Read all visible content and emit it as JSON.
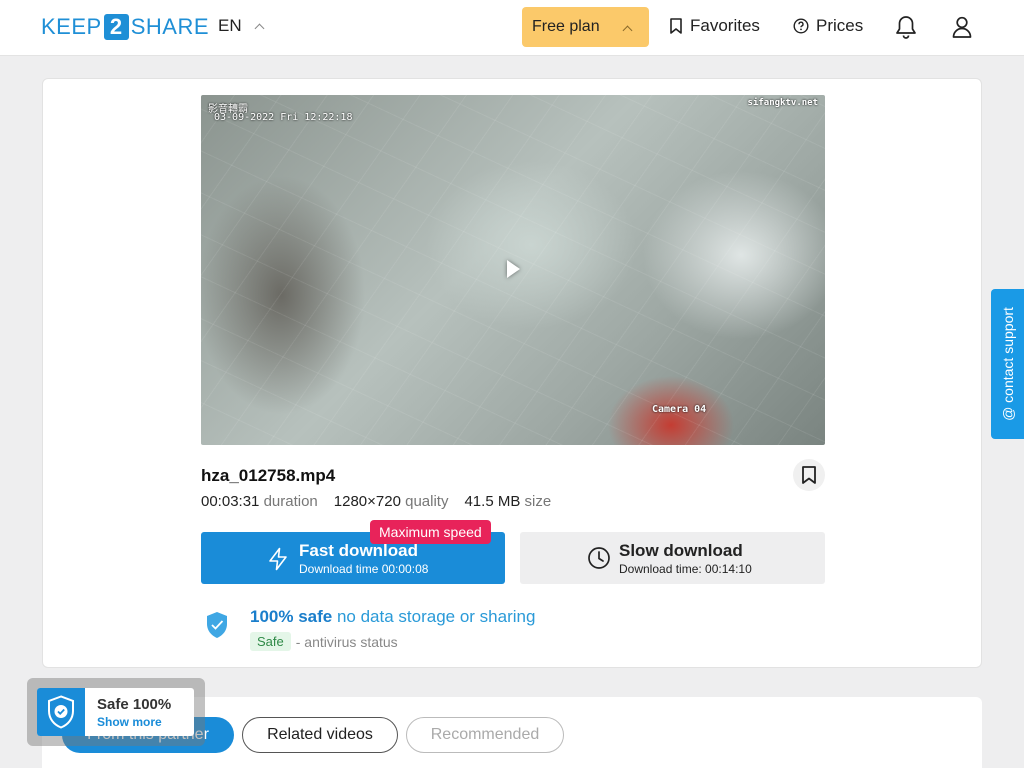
{
  "header": {
    "logo_left": "KEEP",
    "logo_mid": "2",
    "logo_right": "SHARE",
    "language": "EN",
    "plan_label": "Free plan",
    "favorites_label": "Favorites",
    "prices_label": "Prices"
  },
  "video": {
    "overlay_top_left": "影音轉霸",
    "overlay_timestamp": "03-09-2022 Fri 12:22:18",
    "overlay_top_right": "sifangktv.net",
    "overlay_camera": "Camera 04"
  },
  "file": {
    "name": "hza_012758.mp4",
    "duration_value": "00:03:31",
    "duration_label": "duration",
    "quality_value": "1280×720",
    "quality_label": "quality",
    "size_value": "41.5 MB",
    "size_label": "size"
  },
  "download": {
    "fast_title": "Fast download",
    "fast_subtitle": "Download time 00:00:08",
    "max_speed_badge": "Maximum speed",
    "slow_title": "Slow download",
    "slow_subtitle": "Download time: 00:14:10"
  },
  "safety": {
    "bold": "100% safe",
    "text": "no data storage or sharing",
    "badge": "Safe",
    "status": "- antivirus status"
  },
  "support_label": "@ contact support",
  "tabs": [
    {
      "label": "From this partner"
    },
    {
      "label": "Related videos"
    },
    {
      "label": "Recommended"
    }
  ],
  "safe_widget": {
    "title": "Safe 100%",
    "link": "Show more"
  },
  "colors": {
    "accent": "#1a8cd8",
    "plan": "#fbc96a",
    "badge": "#e8235a"
  }
}
